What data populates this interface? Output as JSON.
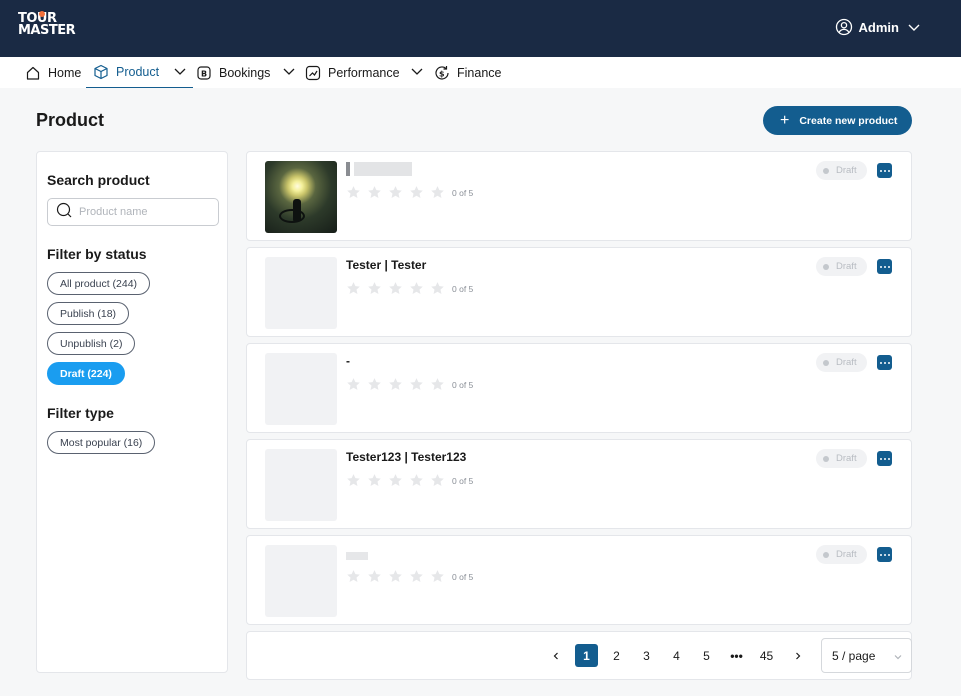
{
  "app": {
    "logo_line1": "TOUR",
    "logo_line2": "MASTER",
    "user_label": "Admin"
  },
  "nav": {
    "items": [
      {
        "label": "Home",
        "icon": "home-icon"
      },
      {
        "label": "Product",
        "icon": "box-icon",
        "active": true
      },
      {
        "label": "Bookings",
        "icon": "bookings-icon"
      },
      {
        "label": "Performance",
        "icon": "chart-trend-icon"
      },
      {
        "label": "Finance",
        "icon": "dollar-refresh-icon"
      }
    ]
  },
  "page": {
    "title": "Product",
    "create_button": "Create new product"
  },
  "sidebar": {
    "search_heading": "Search product",
    "search_placeholder": "Product name",
    "status_heading": "Filter by status",
    "status_chips": [
      "All product (244)",
      "Publish (18)",
      "Unpublish (2)",
      "Draft (224)"
    ],
    "selected_status": "Draft (224)",
    "type_heading": "Filter type",
    "type_chips": [
      "Most popular (16)"
    ]
  },
  "products": [
    {
      "name": "",
      "rating_text": "0 of 5",
      "status": "Draft"
    },
    {
      "name": "Tester | Tester",
      "rating_text": "0 of 5",
      "status": "Draft"
    },
    {
      "name": "-",
      "rating_text": "0 of 5",
      "status": "Draft"
    },
    {
      "name": "Tester123 | Tester123",
      "rating_text": "0 of 5",
      "status": "Draft"
    },
    {
      "name": "",
      "rating_text": "0 of 5",
      "status": "Draft"
    }
  ],
  "pagination": {
    "pages": [
      "1",
      "2",
      "3",
      "4",
      "5",
      "•••",
      "45"
    ],
    "current": "1",
    "prev": "<",
    "next": ">",
    "page_size": "5 / page"
  },
  "colors": {
    "topbar": "#1a2a44",
    "accent": "#135d8f",
    "selected_chip": "#1a9df0"
  }
}
